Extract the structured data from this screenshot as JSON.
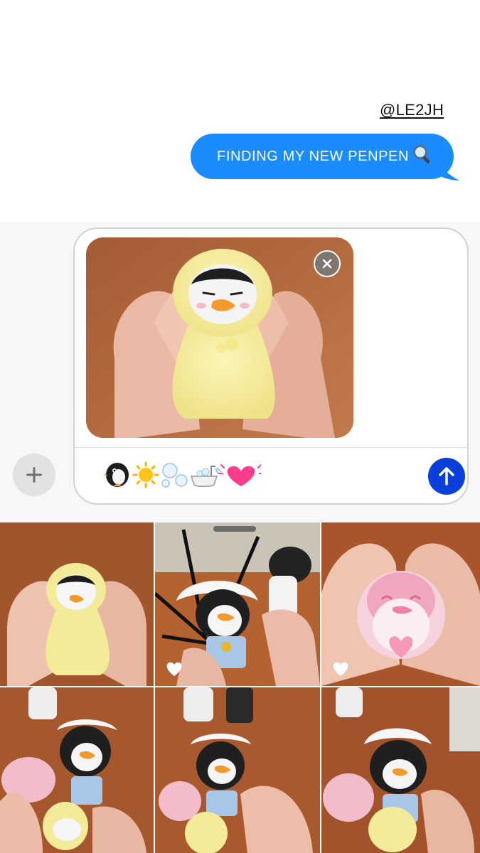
{
  "mention": "@LE2JH",
  "message": {
    "text": "FINDING MY NEW PENPEN",
    "trailing_emoji": "🔍"
  },
  "composer": {
    "attachment_name": "penguin plush in yellow hood held in hands",
    "input_emoji": [
      "penguin",
      "sun",
      "bubbles",
      "bathtub",
      "growing-heart"
    ]
  },
  "colors": {
    "bubble": "#1a8cff",
    "send": "#0a3fd9",
    "table": "#a0552c"
  },
  "photo_grid": [
    {
      "subject": "yellow hooded penguin plush in hands",
      "favorite": false
    },
    {
      "subject": "penguin plush with white bath cap and blue outfit",
      "favorite": true
    },
    {
      "subject": "pink penguin plush framed by heart hands",
      "favorite": true
    },
    {
      "subject": "three penguin plushes together",
      "favorite": false
    },
    {
      "subject": "three penguin plushes together",
      "favorite": false
    },
    {
      "subject": "three penguin plushes together",
      "favorite": false
    }
  ]
}
